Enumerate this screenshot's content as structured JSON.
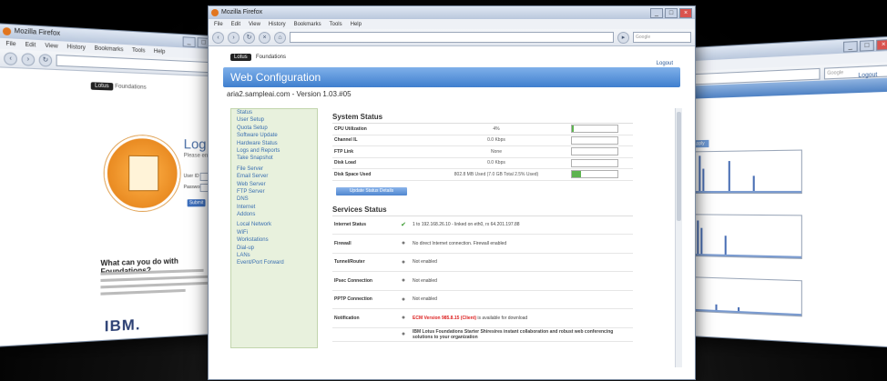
{
  "browser": {
    "title": "Mozilla Firefox",
    "menu": [
      "File",
      "Edit",
      "View",
      "History",
      "Bookmarks",
      "Tools",
      "Help"
    ],
    "search_placeholder": "Google"
  },
  "left_window": {
    "login_title": "Log In",
    "login_sub": "Please enter y",
    "user_label": "User ID",
    "password_label": "Password",
    "submit_label": "Submit",
    "what_can_title": "What can you do with Foundations?",
    "ibm_logo": "IBM."
  },
  "main_window": {
    "brand_badge": "Lotus",
    "brand_name": "Foundations",
    "logout": "Logout",
    "banner": "Web Configuration",
    "host_line": "aria2.sampleai.com - Version 1.03.#05",
    "sidebar": [
      "Status",
      "User Setup",
      "Quota Setup",
      "Software Update",
      "Hardware Status",
      "Logs and Reports",
      "Take Snapshot",
      "File Server",
      "Email Server",
      "Web Server",
      "FTP Server",
      "DNS",
      "Internet",
      "Addons",
      "Local Network",
      "WiFi",
      "Workstations",
      "Dial-up",
      "LANs",
      "Event/Port Forward"
    ],
    "system_status_title": "System Status",
    "system_rows": [
      {
        "label": "CPU Utilization",
        "value": "4%",
        "fill": 0.04
      },
      {
        "label": "Channel IL",
        "value": "0.0 Kbps",
        "fill": 0
      },
      {
        "label": "FTP Link",
        "value": "None",
        "fill": 0
      },
      {
        "label": "Disk Load",
        "value": "0.0 Kbps",
        "fill": 0
      },
      {
        "label": "Disk Space Used",
        "value": "802.8 MB Used (7.0 GB Total 2.5% Used)",
        "fill": 0.2
      }
    ],
    "update_button": "Update Status Details",
    "services_title": "Services Status",
    "services": [
      {
        "label": "Internet Status",
        "icon": "✔",
        "ok": true,
        "text": "1 to 192.168.26.10 - linked on eth0, rx 64.201.197.88",
        "warn": ""
      },
      {
        "label": "Firewall",
        "icon": "●",
        "ok": false,
        "text": "No direct Internet connection. Firewall enabled",
        "warn": ""
      },
      {
        "label": "Tunnel/Router",
        "icon": "●",
        "ok": false,
        "text": "Not enabled",
        "warn": ""
      },
      {
        "label": "IPsec Connection",
        "icon": "●",
        "ok": false,
        "text": "Not enabled",
        "warn": ""
      },
      {
        "label": "PPTP Connection",
        "icon": "●",
        "ok": false,
        "text": "Not enabled",
        "warn": ""
      },
      {
        "label": "Notification",
        "icon": "●",
        "ok": false,
        "text": " is available for download",
        "warn": "ECM Version 985.8.15 (Client)"
      }
    ],
    "footer_text": "IBM Lotus Foundations Starter Shiresires instant collaboration and robust web conferencing solutions to your organization"
  },
  "right_window": {
    "logout": "Logout",
    "tab": "Apply"
  }
}
